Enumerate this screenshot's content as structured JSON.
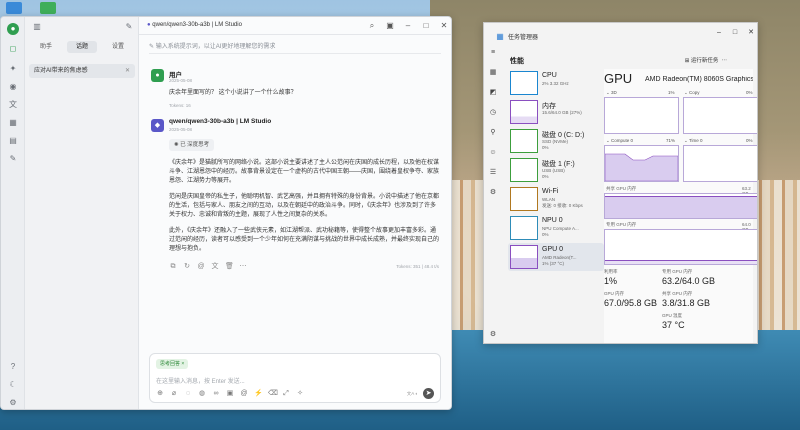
{
  "lmstudio": {
    "sidebar_tabs": [
      "助手",
      "话题",
      "设置"
    ],
    "conversation": "应对AI带来的焦虑感",
    "title": "qwen/qwen3-30b-a3b | LM Studio",
    "system_prompt_placeholder": "输入系统提示词，以让AI更好地理解您的需求",
    "user_label": "用户",
    "user_time": "2025-05-08",
    "user_message": "庆余年里面写的？ 这个小说讲了一个什么故事？",
    "user_tokens": "Tokens: 16",
    "model_name": "qwen/qwen3-30b-a3b | LM Studio",
    "model_time": "2025-05-08",
    "thought_label": "已 深度思考",
    "answer_p1": "《庆余年》是猫腻所写的网络小说。这部小说主要讲述了主人公范闲在庆国的成长历程，以及他在权谋斗争、江湖恩怨中的经历。故事背景设定在一个虚构的古代中国王朝——庆国，围绕着皇权争夺、家族恩怨、江湖势力等展开。",
    "answer_p2": "范闲是庆国皇帝的私生子，他聪明机智、武艺高强，并且拥有特殊的身份背景。小说中描述了他在京都的生活，包括与家人、朋友之间的互动，以及在朝廷中的政治斗争。同时，《庆余年》也涉及到了许多关于权力、忠诚和背叛的主题，展现了人性之间复杂的关系。",
    "answer_p3": "此外，《庆余年》还融入了一些武侠元素，如江湖帮派、武功秘籍等，使得整个故事更加丰富多彩。通过范闲的经历，读者可以感受到一个少年如何在充满阴谋与挑战的世界中成长成熟，并最终实现自己的理想与抱负。",
    "stats": "Tokens: 351 | 48.4 t/s",
    "input_chip": "思考回答 ×",
    "input_placeholder": "在这里输入消息，按 Enter 发送..."
  },
  "taskmgr": {
    "title": "任务管理器",
    "section": "性能",
    "run_task": "运行新任务",
    "items": [
      {
        "name": "CPU",
        "sub": "2% 3.32 GHz",
        "color": "#1a86d0"
      },
      {
        "name": "内存",
        "sub": "15.6/64.0 GB (27%)",
        "color": "#8a4fc0"
      },
      {
        "name": "磁盘 0 (C: D:)",
        "sub": "SSD (NVMe)\n0%",
        "color": "#3c9e3c"
      },
      {
        "name": "磁盘 1 (F:)",
        "sub": "USB (USB)\n0%",
        "color": "#3c9e3c"
      },
      {
        "name": "Wi-Fi",
        "sub": "WLAN\n发送: 0 接收: 0 Kbps",
        "color": "#b07820"
      },
      {
        "name": "NPU 0",
        "sub": "NPU Compute A...\n0%",
        "color": "#2e8cb8"
      },
      {
        "name": "GPU 0",
        "sub": "AMD Radeon(T...\n1% (37 °C)",
        "color": "#8a4fc0"
      }
    ],
    "gpu_heading": "GPU",
    "gpu_model": "AMD Radeon(TM) 8060S Graphics",
    "engines": [
      "3D",
      "Copy",
      "Compute 0",
      "Time 0"
    ],
    "engine_pct": [
      "1%",
      "0%",
      "71%",
      "0%"
    ],
    "shared_label": "共享 GPU 内存",
    "shared_max": "63.2 GB",
    "dedicated_label": "专用 GPU 内存",
    "dedicated_max": "64.0 GB",
    "stats": {
      "util_label": "利用率",
      "util": "1%",
      "dedicated_label": "专用 GPU 内存",
      "dedicated": "63.2/64.0 GB",
      "gpu_mem_label": "GPU 内存",
      "gpu_mem": "67.0/95.8 GB",
      "shared_label": "共享 GPU 内存",
      "shared": "3.8/31.8 GB",
      "temp_label": "GPU 温度",
      "temp": "37 °C"
    }
  }
}
